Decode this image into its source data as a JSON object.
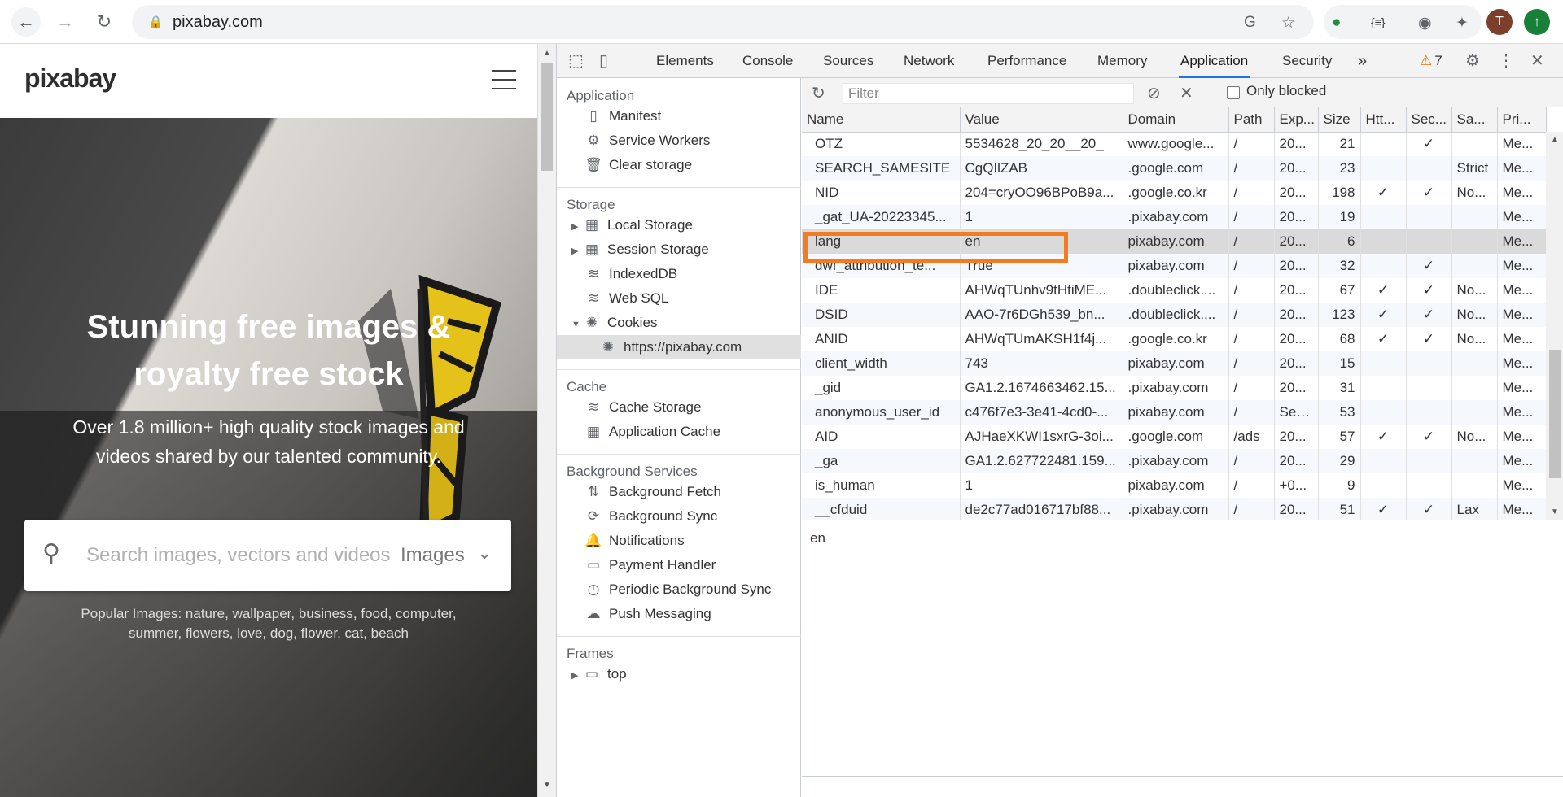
{
  "browser": {
    "url": "pixabay.com",
    "avatar_letter": "T"
  },
  "page": {
    "logo": "pixabay",
    "hero_title_line1": "Stunning free images &",
    "hero_title_line2": "royalty free stock",
    "hero_subtitle_line1": "Over 1.8 million+ high quality stock images and",
    "hero_subtitle_line2": "videos shared by our talented community.",
    "search_placeholder": "Search images, vectors and videos",
    "search_type": "Images",
    "popular_line1": "Popular Images: nature, wallpaper, business, food, computer,",
    "popular_line2": "summer, flowers, love, dog, flower, cat, beach"
  },
  "devtools": {
    "tabs": [
      "Elements",
      "Console",
      "Sources",
      "Network",
      "Performance",
      "Memory",
      "Application",
      "Security"
    ],
    "active_tab": "Application",
    "more_tabs": "»",
    "warning_count": "7",
    "sidebar": {
      "application_title": "Application",
      "application_items": [
        "Manifest",
        "Service Workers",
        "Clear storage"
      ],
      "storage_title": "Storage",
      "storage_items": [
        "Local Storage",
        "Session Storage",
        "IndexedDB",
        "Web SQL",
        "Cookies"
      ],
      "cookies_child": "https://pixabay.com",
      "cache_title": "Cache",
      "cache_items": [
        "Cache Storage",
        "Application Cache"
      ],
      "bg_title": "Background Services",
      "bg_items": [
        "Background Fetch",
        "Background Sync",
        "Notifications",
        "Payment Handler",
        "Periodic Background Sync",
        "Push Messaging"
      ],
      "frames_title": "Frames",
      "frames_child": "top"
    },
    "toolbar": {
      "filter_placeholder": "Filter",
      "only_blocked": "Only blocked"
    },
    "columns": [
      "Name",
      "Value",
      "Domain",
      "Path",
      "Exp...",
      "Size",
      "Htt...",
      "Sec...",
      "Sa...",
      "Pri..."
    ],
    "rows": [
      [
        "OTZ",
        "5534628_20_20__20_",
        "www.google...",
        "/",
        "20...",
        "21",
        "",
        "✓",
        "",
        "Me..."
      ],
      [
        "SEARCH_SAMESITE",
        "CgQIlZAB",
        ".google.com",
        "/",
        "20...",
        "23",
        "",
        "",
        "Strict",
        "Me..."
      ],
      [
        "NID",
        "204=cryOO96BPoB9a...",
        ".google.co.kr",
        "/",
        "20...",
        "198",
        "✓",
        "✓",
        "No...",
        "Me..."
      ],
      [
        "_gat_UA-20223345...",
        "1",
        ".pixabay.com",
        "/",
        "20...",
        "19",
        "",
        "",
        "",
        "Me..."
      ],
      [
        "lang",
        "en",
        "pixabay.com",
        "/",
        "20...",
        "6",
        "",
        "",
        "",
        "Me..."
      ],
      [
        "dwf_attribution_te...",
        "True",
        "pixabay.com",
        "/",
        "20...",
        "32",
        "",
        "✓",
        "",
        "Me..."
      ],
      [
        "IDE",
        "AHWqTUnhv9tHtiME...",
        ".doubleclick....",
        "/",
        "20...",
        "67",
        "✓",
        "✓",
        "No...",
        "Me..."
      ],
      [
        "DSID",
        "AAO-7r6DGh539_bn...",
        ".doubleclick....",
        "/",
        "20...",
        "123",
        "✓",
        "✓",
        "No...",
        "Me..."
      ],
      [
        "ANID",
        "AHWqTUmAKSH1f4j...",
        ".google.co.kr",
        "/",
        "20...",
        "68",
        "✓",
        "✓",
        "No...",
        "Me..."
      ],
      [
        "client_width",
        "743",
        "pixabay.com",
        "/",
        "20...",
        "15",
        "",
        "",
        "",
        "Me..."
      ],
      [
        "_gid",
        "GA1.2.1674663462.15...",
        ".pixabay.com",
        "/",
        "20...",
        "31",
        "",
        "",
        "",
        "Me..."
      ],
      [
        "anonymous_user_id",
        "c476f7e3-3e41-4cd0-...",
        "pixabay.com",
        "/",
        "Ses...",
        "53",
        "",
        "",
        "",
        "Me..."
      ],
      [
        "AID",
        "AJHaeXKWI1sxrG-3oi...",
        ".google.com",
        "/ads",
        "20...",
        "57",
        "✓",
        "✓",
        "No...",
        "Me..."
      ],
      [
        "_ga",
        "GA1.2.627722481.159...",
        ".pixabay.com",
        "/",
        "20...",
        "29",
        "",
        "",
        "",
        "Me..."
      ],
      [
        "is_human",
        "1",
        "pixabay.com",
        "/",
        "+0...",
        "9",
        "",
        "",
        "",
        "Me..."
      ],
      [
        "__cfduid",
        "de2c77ad016717bf88...",
        ".pixabay.com",
        "/",
        "20...",
        "51",
        "✓",
        "✓",
        "Lax",
        "Me..."
      ]
    ],
    "selected_row": 4,
    "preview_value": "en"
  }
}
